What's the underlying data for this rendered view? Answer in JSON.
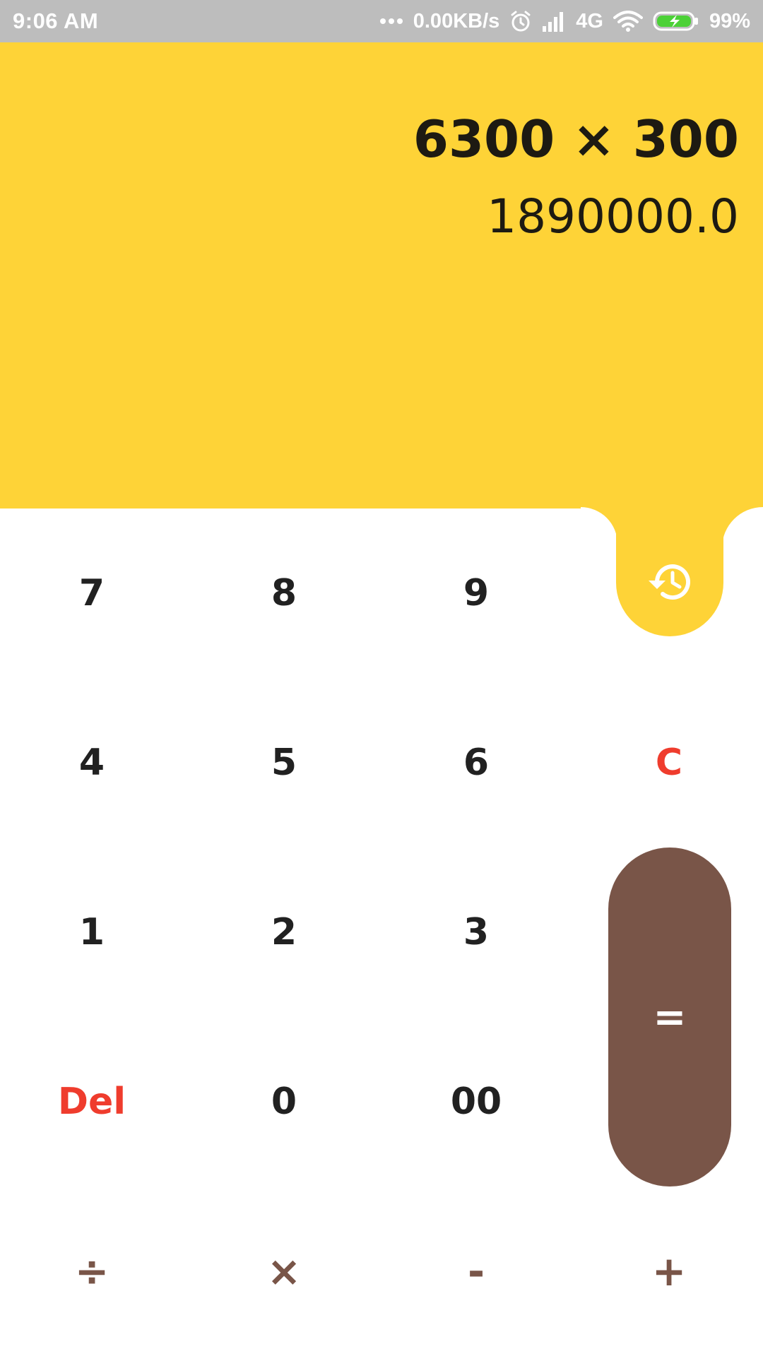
{
  "status_bar": {
    "time": "9:06 AM",
    "network_speed": "0.00KB/s",
    "network_type": "4G",
    "battery": "99%",
    "icons": [
      "more-dots-icon",
      "alarm-icon",
      "signal-icon",
      "wifi-icon",
      "battery-charging-icon"
    ]
  },
  "display": {
    "expression": "6300 × 300",
    "result": "1890000.0"
  },
  "history": {
    "icon": "history-icon"
  },
  "keys": {
    "seven": "7",
    "eight": "8",
    "nine": "9",
    "four": "4",
    "five": "5",
    "six": "6",
    "clear": "C",
    "one": "1",
    "two": "2",
    "three": "3",
    "equals": "=",
    "delete": "Del",
    "zero": "0",
    "double_zero": "00",
    "divide": "÷",
    "multiply": "×",
    "subtract": "-",
    "add": "+"
  },
  "colors": {
    "display_background": "#fed337",
    "equals_background": "#795548",
    "operator_text": "#795548",
    "accent_red": "#ef3c2d",
    "status_bar": "#bdbdbd"
  }
}
